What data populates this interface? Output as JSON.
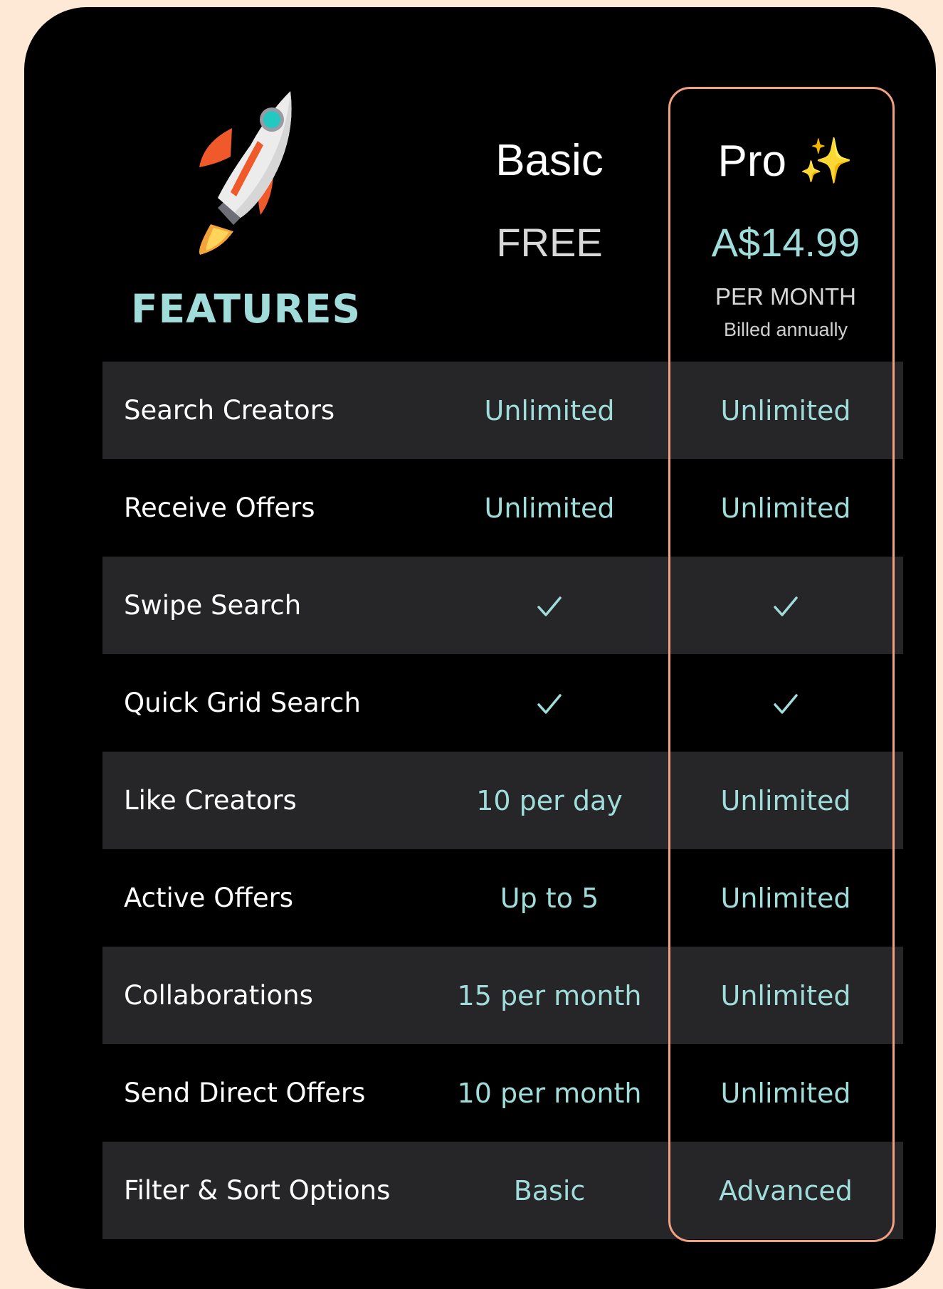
{
  "features_title": "FEATURES",
  "plans": {
    "basic": {
      "name": "Basic",
      "price": "FREE"
    },
    "pro": {
      "name": "Pro",
      "badge": "✨",
      "price": "A$14.99",
      "period": "PER MONTH",
      "billing": "Billed annually"
    }
  },
  "rows": [
    {
      "feature": "Search Creators",
      "basic": "Unlimited",
      "pro": "Unlimited"
    },
    {
      "feature": "Receive Offers",
      "basic": "Unlimited",
      "pro": "Unlimited"
    },
    {
      "feature": "Swipe Search",
      "basic": "",
      "pro": ""
    },
    {
      "feature": "Quick Grid Search",
      "basic": "",
      "pro": ""
    },
    {
      "feature": "Like Creators",
      "basic": "10 per day",
      "pro": "Unlimited"
    },
    {
      "feature": "Active Offers",
      "basic": "Up to 5",
      "pro": "Unlimited"
    },
    {
      "feature": "Collaborations",
      "basic": "15 per month",
      "pro": "Unlimited"
    },
    {
      "feature": "Send Direct Offers",
      "basic": "10 per month",
      "pro": "Unlimited"
    },
    {
      "feature": "Filter & Sort Options",
      "basic": "Basic",
      "pro": "Advanced"
    }
  ],
  "colors": {
    "accent": "#9fdcda",
    "highlight_border": "#f2a07f",
    "background": "#fde9d6",
    "card": "#000000",
    "row_shade": "#262628"
  },
  "icons": {
    "logo": "rocket-icon",
    "included": "checkmark-icon",
    "pro_badge": "sparkles-icon"
  }
}
